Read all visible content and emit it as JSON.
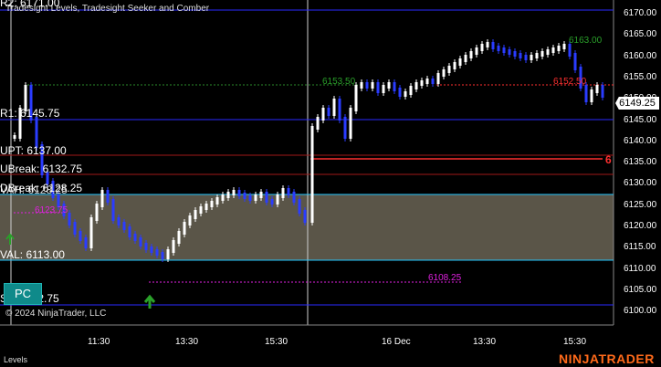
{
  "indicator_title": "Tradesight Levels, Tradesight Seeker and Comber",
  "copyright": "© 2024 NinjaTrader, LLC",
  "footer_left": "Levels",
  "brand": "NINJATRADER",
  "pc_button": "PC",
  "current_price": "6149.25",
  "level_labels": {
    "r2": "R2: 6171.00",
    "r1": "R1: 6145.75",
    "upt": "UPT: 6137.00",
    "ubreak": "UBreak: 6132.75",
    "dbreak": "DBreak: 6128.25",
    "vah": "VAH: 6128.25",
    "val": "VAL: 6113.00",
    "s1": "S1: 6102.75"
  },
  "annotations": {
    "left_mid": "6123.75",
    "bottom_mid": "6108.25",
    "right_top_green": "6153.50",
    "right_red": "6152.50",
    "top_right_green": "6163.00",
    "red_six": "6"
  },
  "y_axis_ticks": [
    "6170.00",
    "6165.00",
    "6160.00",
    "6155.00",
    "6150.00",
    "6145.00",
    "6140.00",
    "6135.00",
    "6130.00",
    "6125.00",
    "6120.00",
    "6115.00",
    "6110.00",
    "6105.00",
    "6100.00"
  ],
  "x_axis_ticks": [
    "11:30",
    "13:30",
    "15:30",
    "16 Dec",
    "13:30",
    "15:30"
  ],
  "colors": {
    "background": "#000000",
    "level_line": "#2a2aff",
    "value_area": "#5a5548",
    "value_line": "#24c8ff",
    "candle_up": "#ffffff",
    "candle_down": "#2a3cff",
    "red_line": "#ff3030",
    "magenta": "#e020e0",
    "green_dash": "#2a8a2a",
    "brand": "#ff6a1a"
  }
}
